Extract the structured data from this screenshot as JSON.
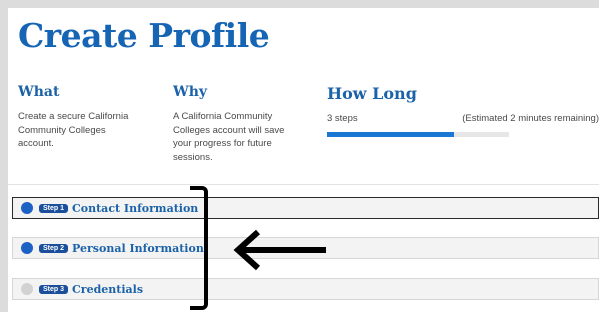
{
  "page": {
    "title": "Create Profile"
  },
  "info": {
    "what": {
      "heading": "What",
      "body": "Create a secure California Community Colleges account."
    },
    "why": {
      "heading": "Why",
      "body": "A California Community Colleges account will save your progress for future sessions."
    },
    "how": {
      "heading": "How Long",
      "steps": "3 steps",
      "estimate": "(Estimated 2 minutes remaining)",
      "progress_fraction": 0.7
    }
  },
  "steps": [
    {
      "badge": "Step 1",
      "label": "Contact Information",
      "status": "active"
    },
    {
      "badge": "Step 2",
      "label": "Personal Information",
      "status": "complete"
    },
    {
      "badge": "Step 3",
      "label": "Credentials",
      "status": "incomplete"
    }
  ],
  "colors": {
    "brand": "#1565b4",
    "progress": "#1b77d4",
    "badge": "#1b4f9c"
  },
  "annotations": {
    "bracket": "bracket-annotation",
    "arrow": "left-arrow-annotation"
  }
}
